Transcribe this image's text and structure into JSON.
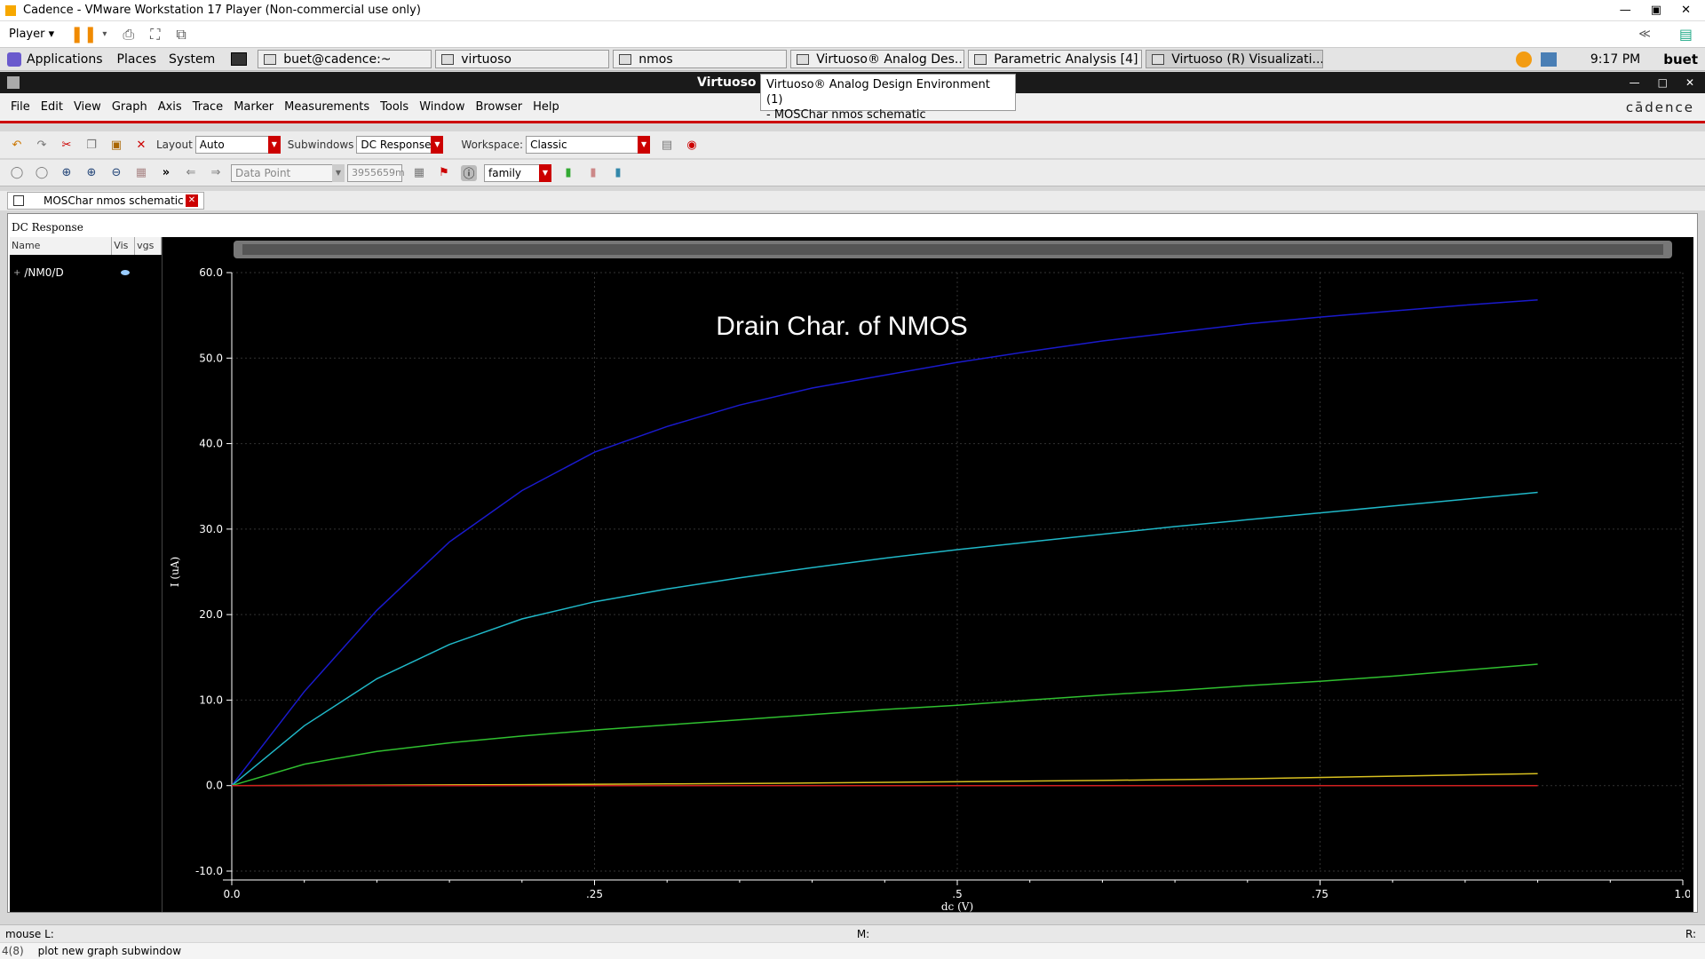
{
  "vm": {
    "title": "Cadence - VMware Workstation 17 Player (Non-commercial use only)",
    "player_label": "Player"
  },
  "panel": {
    "applications": "Applications",
    "places": "Places",
    "system": "System",
    "tasks": [
      "buet@cadence:~",
      "virtuoso",
      "nmos",
      "Virtuoso® Analog Des...",
      "Parametric Analysis [4]",
      "Virtuoso (R) Visualizati..."
    ],
    "clock": "9:17 PM",
    "user": "buet"
  },
  "window": {
    "title": "Virtuoso",
    "tooltip_line1": "Virtuoso® Analog Design Environment (1)",
    "tooltip_line2": "- MOSChar nmos schematic"
  },
  "menu": [
    "File",
    "Edit",
    "View",
    "Graph",
    "Axis",
    "Trace",
    "Marker",
    "Measurements",
    "Tools",
    "Window",
    "Browser",
    "Help"
  ],
  "brand": "cādence",
  "toolbar": {
    "layout_label": "Layout",
    "layout_value": "Auto",
    "subwindows_label": "Subwindows",
    "subwindows_value": "DC Response",
    "workspace_label": "Workspace:",
    "workspace_value": "Classic",
    "more": "»",
    "data_point_value": "Data Point",
    "coord_value": "3955659m",
    "family_value": "family"
  },
  "tab": {
    "label": "MOSChar nmos schematic"
  },
  "subwindow": {
    "title": "DC Response",
    "col_name": "Name",
    "col_vis": "Vis",
    "col_vgs": "vgs",
    "signal": "/NM0/D",
    "expander": "+"
  },
  "chart_data": {
    "type": "line",
    "title": "Drain Char. of NMOS",
    "xlabel": "dc (V)",
    "ylabel": "I (uA)",
    "xlim": [
      0,
      1.0
    ],
    "ylim": [
      -10,
      60
    ],
    "xticks": [
      0,
      0.25,
      0.5,
      0.75,
      1.0
    ],
    "xtick_labels": [
      "0.0",
      ".25",
      ".5",
      ".75",
      "1.0"
    ],
    "yticks": [
      -10,
      0,
      10,
      20,
      30,
      40,
      50,
      60
    ],
    "ytick_labels": [
      "-10.0",
      "0.0",
      "10.0",
      "20.0",
      "30.0",
      "40.0",
      "50.0",
      "60.0"
    ],
    "grid": true,
    "series": [
      {
        "color": "#1a1acc",
        "x": [
          0,
          0.05,
          0.1,
          0.15,
          0.2,
          0.25,
          0.3,
          0.35,
          0.4,
          0.45,
          0.5,
          0.55,
          0.6,
          0.65,
          0.7,
          0.75,
          0.8,
          0.85,
          0.9
        ],
        "y": [
          0,
          11,
          20.5,
          28.5,
          34.5,
          39,
          42,
          44.5,
          46.5,
          48,
          49.5,
          50.8,
          52,
          53,
          54,
          54.8,
          55.5,
          56.2,
          56.8
        ]
      },
      {
        "color": "#20b8c8",
        "x": [
          0,
          0.05,
          0.1,
          0.15,
          0.2,
          0.25,
          0.3,
          0.35,
          0.4,
          0.45,
          0.5,
          0.55,
          0.6,
          0.65,
          0.7,
          0.75,
          0.8,
          0.85,
          0.9
        ],
        "y": [
          0,
          7,
          12.5,
          16.5,
          19.5,
          21.5,
          23,
          24.3,
          25.5,
          26.6,
          27.6,
          28.5,
          29.4,
          30.3,
          31.1,
          31.9,
          32.7,
          33.5,
          34.3
        ]
      },
      {
        "color": "#30c030",
        "x": [
          0,
          0.05,
          0.1,
          0.15,
          0.2,
          0.25,
          0.3,
          0.35,
          0.4,
          0.45,
          0.5,
          0.55,
          0.6,
          0.65,
          0.7,
          0.75,
          0.8,
          0.85,
          0.9
        ],
        "y": [
          0,
          2.5,
          4,
          5,
          5.8,
          6.5,
          7.1,
          7.7,
          8.3,
          8.9,
          9.4,
          10,
          10.6,
          11.1,
          11.7,
          12.2,
          12.8,
          13.5,
          14.2
        ]
      },
      {
        "color": "#d8c020",
        "x": [
          0,
          0.1,
          0.2,
          0.3,
          0.4,
          0.5,
          0.6,
          0.7,
          0.8,
          0.9
        ],
        "y": [
          0,
          0.05,
          0.12,
          0.2,
          0.3,
          0.45,
          0.6,
          0.8,
          1.1,
          1.4
        ]
      },
      {
        "color": "#d02020",
        "x": [
          0,
          0.3,
          0.6,
          0.9
        ],
        "y": [
          0,
          0,
          0,
          0
        ]
      }
    ]
  },
  "status": {
    "mouse_l": "mouse L:",
    "m": "M:",
    "r": "R:",
    "count": "4(8)",
    "message": "plot new graph subwindow"
  }
}
